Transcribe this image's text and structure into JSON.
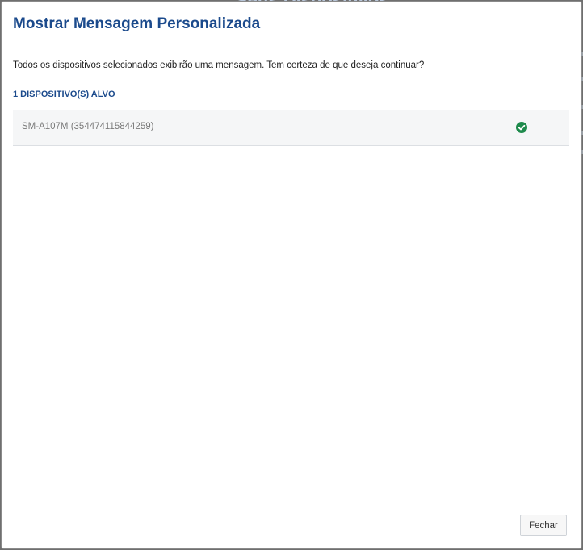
{
  "background": {
    "title": "Seus Dispositivos"
  },
  "modal": {
    "title": "Mostrar Mensagem Personalizada",
    "message": "Todos os dispositivos selecionados exibirão uma mensagem. Tem certeza de que deseja continuar?",
    "targets_label": "1 DISPOSITIVO(S) ALVO",
    "devices": [
      {
        "name": "SM-A107M (354474115844259)",
        "status": "success",
        "status_icon": "check-circle-icon"
      }
    ],
    "close_label": "Fechar"
  },
  "colors": {
    "title": "#1b4a8c",
    "success": "#1e8a4c",
    "row_background": "#f5f6f7"
  }
}
